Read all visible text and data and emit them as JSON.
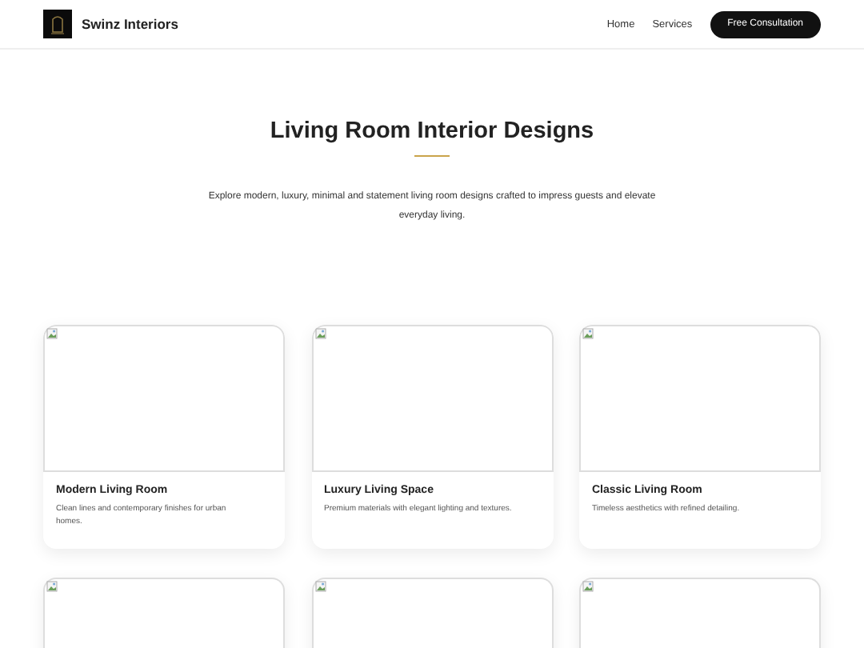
{
  "header": {
    "brand": "Swinz Interiors",
    "nav": [
      {
        "label": "Home"
      },
      {
        "label": "Services"
      }
    ],
    "cta": "Free Consultation"
  },
  "hero": {
    "title": "Living Room Interior Designs",
    "description": "Explore modern, luxury, minimal and statement living room designs crafted to impress guests and elevate everyday living."
  },
  "cards": [
    {
      "title": "Modern Living Room",
      "description": "Clean lines and contemporary finishes for urban homes."
    },
    {
      "title": "Luxury Living Space",
      "description": "Premium materials with elegant lighting and textures."
    },
    {
      "title": "Classic Living Room",
      "description": "Timeless aesthetics with refined detailing."
    },
    {
      "kind": "cut"
    },
    {
      "kind": "cut"
    },
    {
      "kind": "cut"
    }
  ]
}
